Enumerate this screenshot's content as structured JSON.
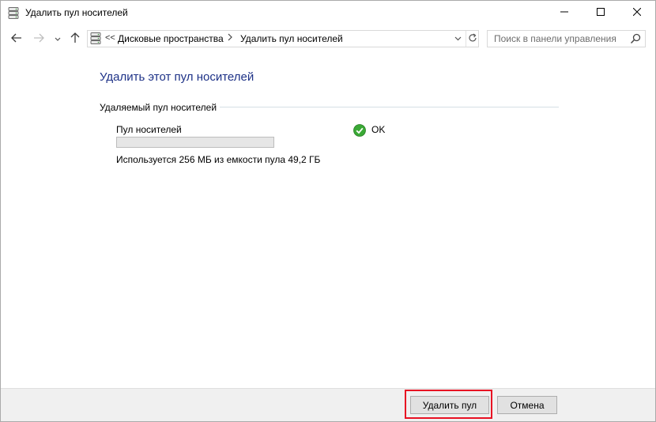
{
  "window": {
    "title": "Удалить пул носителей",
    "icon": "storage-spaces-icon"
  },
  "nav": {
    "address_overflow": "<<",
    "breadcrumbs": [
      "Дисковые пространства",
      "Удалить пул носителей"
    ],
    "search_placeholder": "Поиск в панели управления"
  },
  "content": {
    "title": "Удалить этот пул носителей",
    "group_label": "Удаляемый пул носителей",
    "pool": {
      "name": "Пул носителей",
      "status": "OK",
      "status_icon": "ok-check-icon",
      "usage_fraction": 0,
      "usage_text": "Используется 256 МБ из емкости пула 49,2 ГБ"
    }
  },
  "footer": {
    "delete_label": "Удалить пул",
    "cancel_label": "Отмена",
    "highlight_color": "#e81123"
  },
  "colors": {
    "title_blue": "#1e3287",
    "status_green": "#3aa935"
  }
}
